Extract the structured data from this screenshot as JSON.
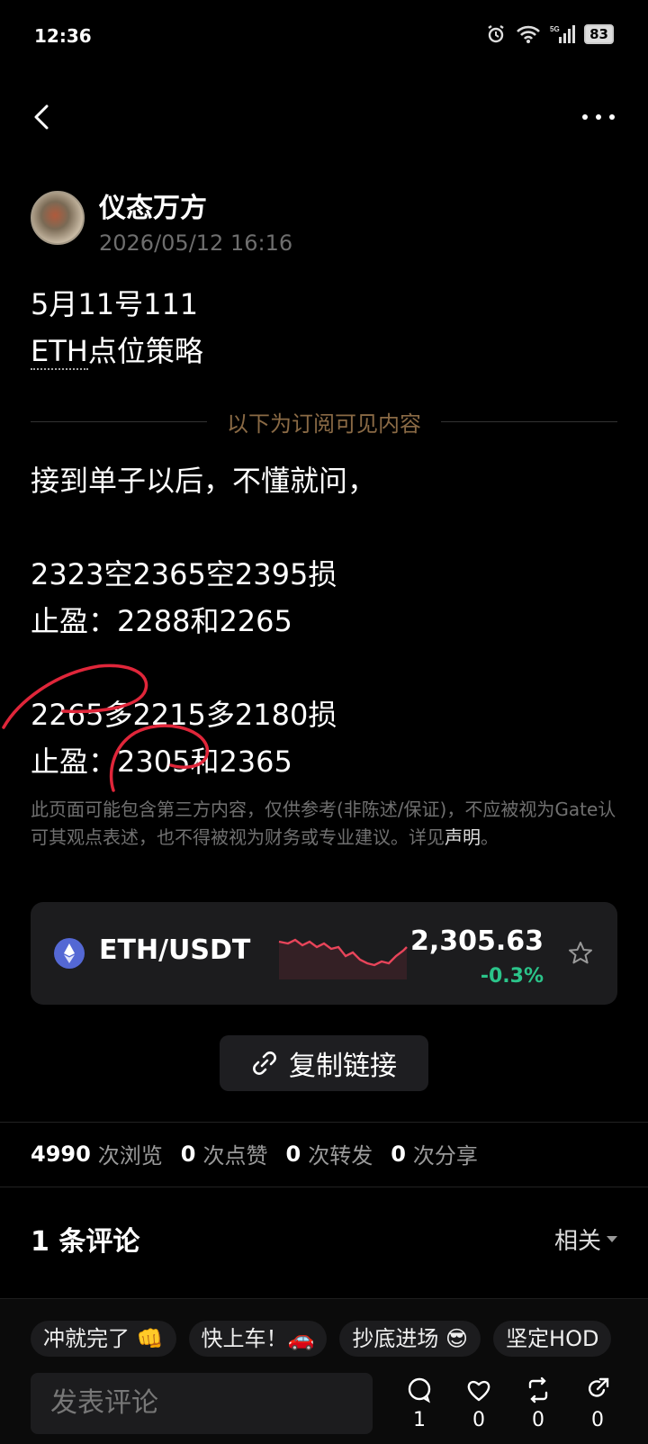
{
  "status": {
    "time": "12:36",
    "battery": "83",
    "network": "5G"
  },
  "author": {
    "name": "仪态万方",
    "time": "2026/05/12 16:16"
  },
  "post": {
    "title_line1": "5月11号111",
    "title_line2_linked": "ETH",
    "title_line2_rest": "点位策略",
    "subscribe_divider": "以下为订阅可见内容",
    "lines": [
      "接到单子以后，不懂就问，",
      "",
      "2323空2365空2395损",
      "止盈：2288和2265",
      "",
      "2265多2215多2180损",
      "止盈：2305和2365"
    ]
  },
  "disclaimer": {
    "text": "此页面可能包含第三方内容，仅供参考(非陈述/保证)，不应被视为Gate认可其观点表述，也不得被视为财务或专业建议。详见",
    "link": "声明",
    "end": "。"
  },
  "market": {
    "pair": "ETH/USDT",
    "price": "2,305.63",
    "change": "-0.3%",
    "change_color": "#2bc48a",
    "icon": "eth-icon"
  },
  "copy_link": {
    "label": "复制链接",
    "icon": "link-icon"
  },
  "stats": {
    "views_count": "4990",
    "views_label": "次浏览",
    "likes_count": "0",
    "likes_label": "次点赞",
    "reposts_count": "0",
    "reposts_label": "次转发",
    "shares_count": "0",
    "shares_label": "次分享"
  },
  "comments": {
    "title": "1 条评论",
    "sort": "相关"
  },
  "quick_replies": [
    "冲就完了 👊",
    "快上车！🚗",
    "抄底进场 😎",
    "坚定HOD"
  ],
  "composer": {
    "placeholder": "发表评论"
  },
  "actions": {
    "comments": "1",
    "likes": "0",
    "reposts": "0",
    "shares": "0"
  }
}
